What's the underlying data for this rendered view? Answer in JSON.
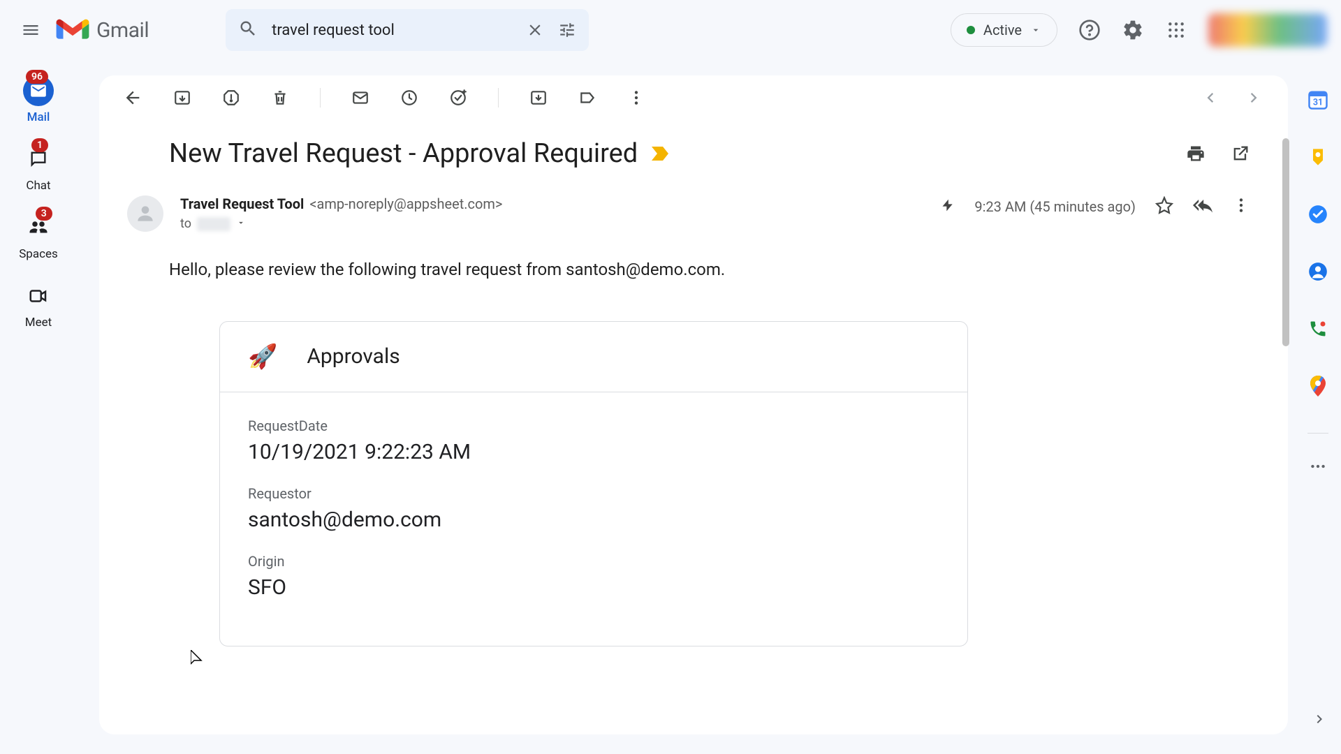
{
  "app": {
    "name": "Gmail"
  },
  "search": {
    "value": "travel request tool"
  },
  "status": {
    "label": "Active"
  },
  "rail": {
    "mail": {
      "label": "Mail",
      "badge": "96"
    },
    "chat": {
      "label": "Chat",
      "badge": "1"
    },
    "spaces": {
      "label": "Spaces",
      "badge": "3"
    },
    "meet": {
      "label": "Meet"
    }
  },
  "email": {
    "subject": "New Travel Request - Approval Required",
    "sender_name": "Travel Request Tool",
    "sender_email": "<amp-noreply@appsheet.com>",
    "to_label": "to",
    "time": "9:23 AM (45 minutes ago)",
    "body_intro": "Hello, please review the following travel request from santosh@demo.com.",
    "card": {
      "title": "Approvals",
      "fields": [
        {
          "label": "RequestDate",
          "value": "10/19/2021 9:22:23 AM"
        },
        {
          "label": "Requestor",
          "value": "santosh@demo.com"
        },
        {
          "label": "Origin",
          "value": "SFO"
        }
      ]
    }
  },
  "side_calendar_day": "31"
}
